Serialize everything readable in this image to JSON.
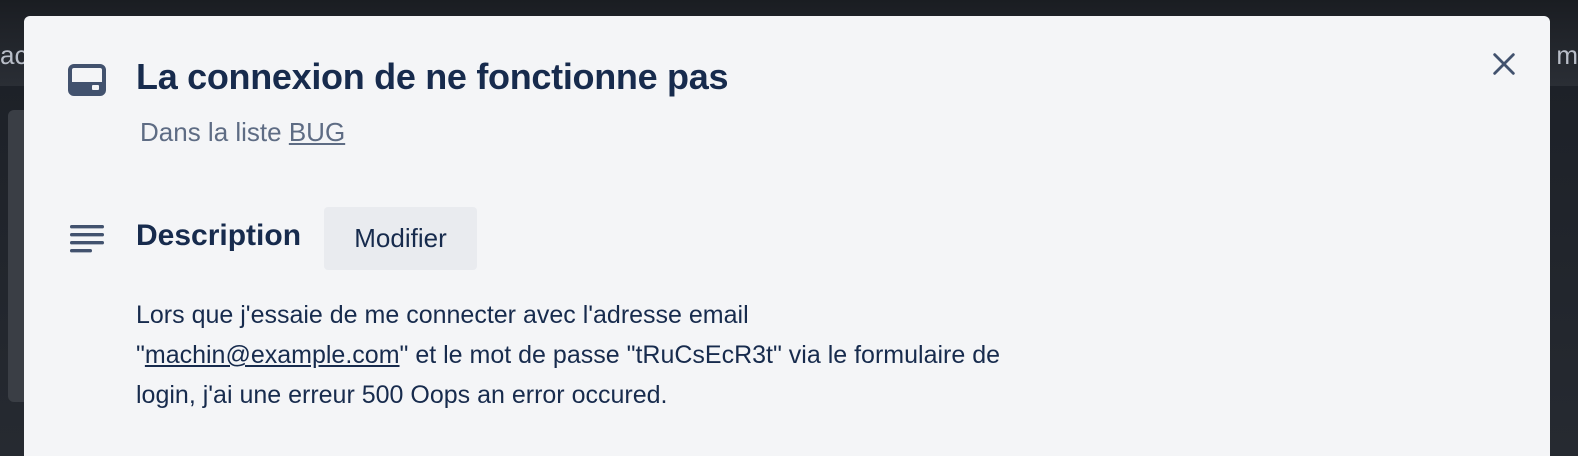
{
  "background": {
    "left_fragment": "ac",
    "right_fragment": "m"
  },
  "card": {
    "title": "La connexion de ne fonctionne pas",
    "subtitle_prefix": "Dans la liste ",
    "list_name": "BUG",
    "icon": "card-icon"
  },
  "description": {
    "heading": "Description",
    "edit_label": "Modifier",
    "icon": "text-lines-icon",
    "line1": "Lors que j'essaie de me connecter avec l'adresse email",
    "quote_open": "\"",
    "email": "machin@example.com",
    "line2_rest": "\" et le mot de passe \"tRuCsEcR3t\" via le formulaire de",
    "line3": "login, j'ai une erreur 500 Oops an error occured."
  },
  "modal": {
    "close_icon": "close-icon"
  },
  "colors": {
    "modal_bg": "#f4f5f7",
    "title": "#172b4d",
    "subtle": "#5e6c84",
    "button_bg": "#e9ebef"
  }
}
